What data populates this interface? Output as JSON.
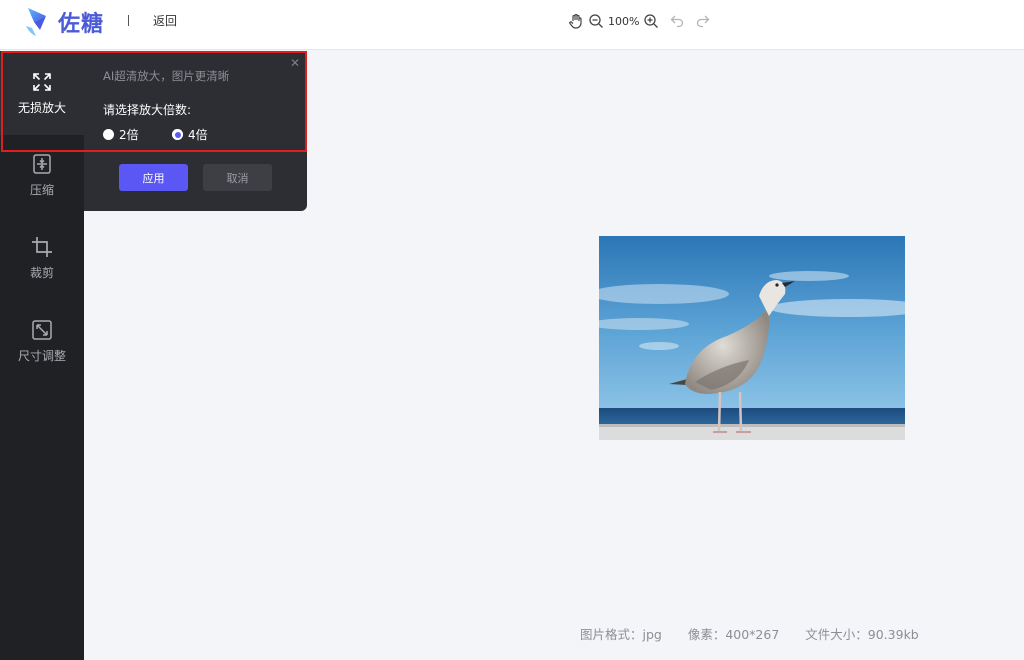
{
  "header": {
    "brand": "佐糖",
    "back_label": "返回",
    "zoom_level": "100%"
  },
  "sidebar": {
    "items": [
      {
        "label": "无损放大",
        "icon": "expand-arrows-icon"
      },
      {
        "label": "压缩",
        "icon": "compress-icon"
      },
      {
        "label": "裁剪",
        "icon": "crop-icon"
      },
      {
        "label": "尺寸调整",
        "icon": "resize-icon"
      }
    ]
  },
  "popup": {
    "description": "AI超清放大，图片更清晰",
    "title": "请选择放大倍数:",
    "options": [
      "2倍",
      "4倍"
    ],
    "selected": "4倍",
    "apply_label": "应用",
    "cancel_label": "取消"
  },
  "image_info": {
    "format": "图片格式：jpg",
    "pixels": "像素：400*267",
    "size": "文件大小：90.39kb"
  },
  "colors": {
    "accent": "#5a57f5",
    "brand": "#4b5bd6",
    "sidebar_bg": "#202125",
    "highlight": "#e01e1e"
  }
}
